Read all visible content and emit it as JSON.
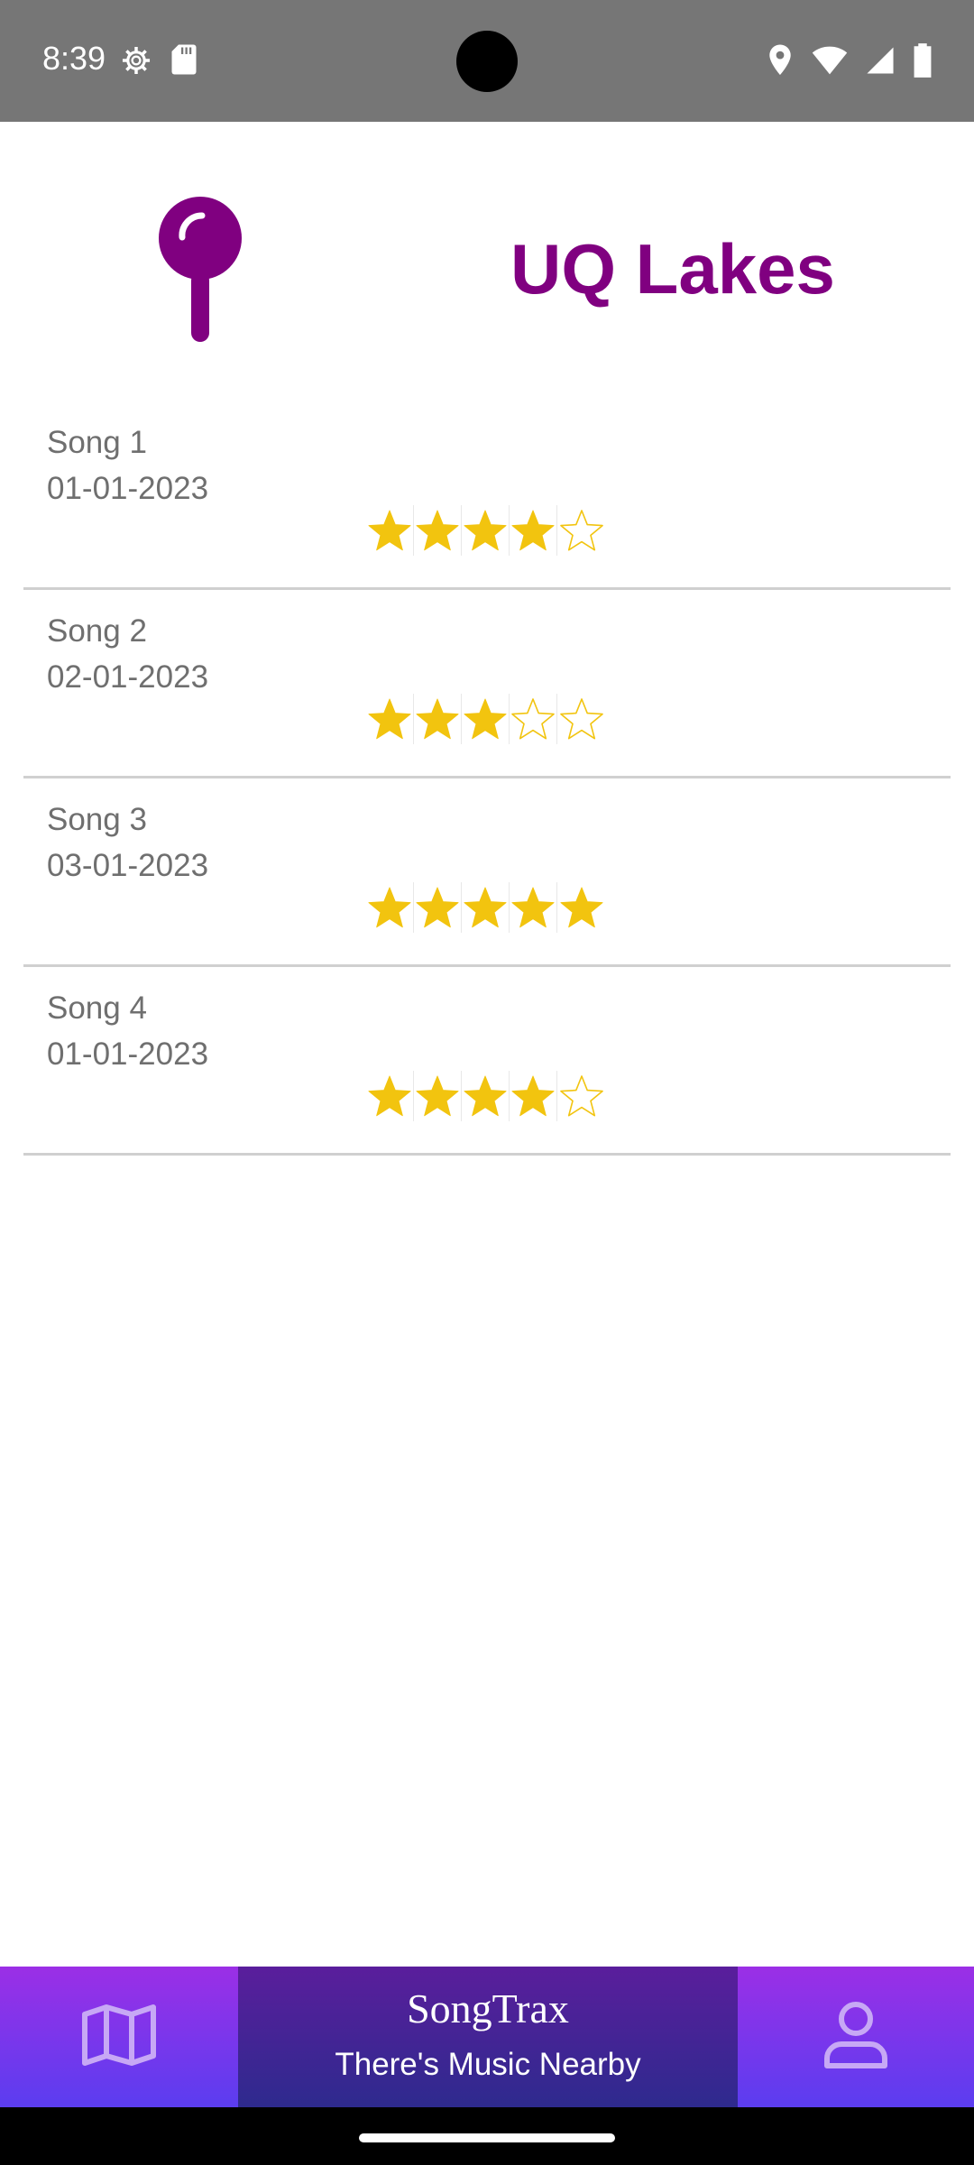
{
  "status_bar": {
    "time": "8:39",
    "left_icons": [
      "settings-icon",
      "sd-card-icon"
    ],
    "right_icons": [
      "location-icon",
      "wifi-icon",
      "signal-icon",
      "battery-icon"
    ]
  },
  "header": {
    "icon": "map-pin-icon",
    "title": "UQ Lakes",
    "title_color": "#800080"
  },
  "songs": [
    {
      "name": "Song 1",
      "date": "01-01-2023",
      "rating": 4,
      "max_rating": 5
    },
    {
      "name": "Song 2",
      "date": "02-01-2023",
      "rating": 3,
      "max_rating": 5
    },
    {
      "name": "Song 3",
      "date": "03-01-2023",
      "rating": 5,
      "max_rating": 5
    },
    {
      "name": "Song 4",
      "date": "01-01-2023",
      "rating": 4,
      "max_rating": 5
    }
  ],
  "star_color": "#f2c40f",
  "bottom_nav": {
    "left_icon": "map-icon",
    "brand_title": "SongTrax",
    "brand_tagline": "There's Music Nearby",
    "right_icon": "profile-icon"
  }
}
